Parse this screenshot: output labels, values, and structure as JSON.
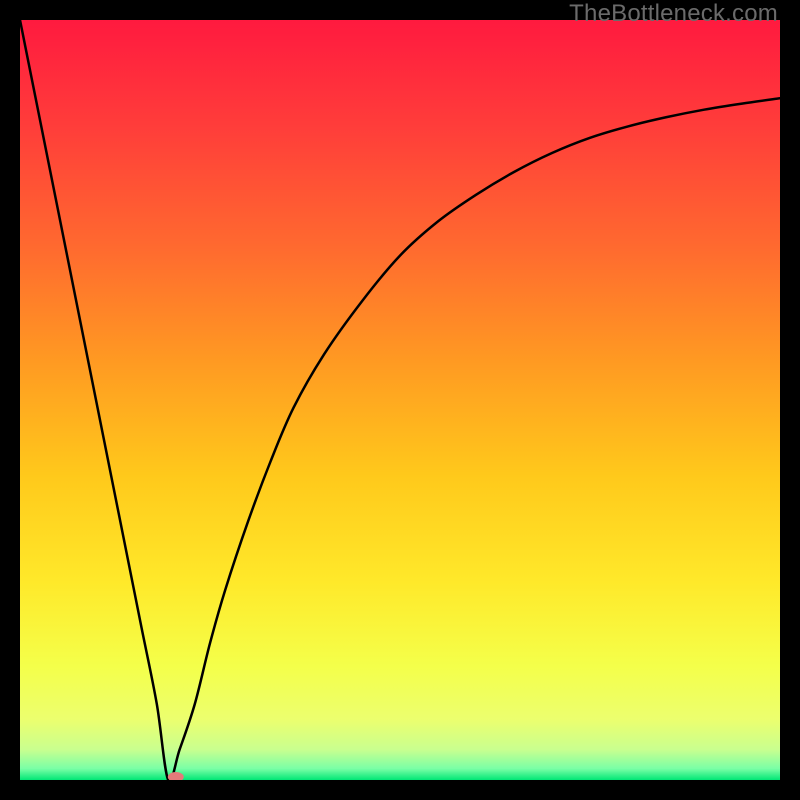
{
  "watermark": "TheBottleneck.com",
  "chart_data": {
    "type": "line",
    "title": "",
    "xlabel": "",
    "ylabel": "",
    "xlim": [
      0,
      100
    ],
    "ylim": [
      0,
      100
    ],
    "x": [
      0,
      2,
      4,
      6,
      8,
      10,
      12,
      14,
      16,
      18,
      19.5,
      21,
      23,
      25,
      27,
      30,
      33,
      36,
      40,
      45,
      50,
      55,
      60,
      65,
      70,
      75,
      80,
      85,
      90,
      95,
      100
    ],
    "values": [
      100,
      90,
      80,
      70,
      60,
      50,
      40,
      30,
      20,
      10,
      0,
      4,
      10,
      18,
      25,
      34,
      42,
      49,
      56,
      63,
      69,
      73.5,
      77,
      80,
      82.5,
      84.5,
      86,
      87.2,
      88.2,
      89,
      89.7
    ],
    "marker": {
      "x": 20.5,
      "y": 0
    },
    "gradient_stops": [
      {
        "offset": 0.0,
        "color": "#ff1a3f"
      },
      {
        "offset": 0.14,
        "color": "#ff3d3a"
      },
      {
        "offset": 0.3,
        "color": "#ff6a2f"
      },
      {
        "offset": 0.45,
        "color": "#ff9a22"
      },
      {
        "offset": 0.6,
        "color": "#ffc91b"
      },
      {
        "offset": 0.74,
        "color": "#ffe92a"
      },
      {
        "offset": 0.85,
        "color": "#f4ff4a"
      },
      {
        "offset": 0.92,
        "color": "#ecff6e"
      },
      {
        "offset": 0.96,
        "color": "#c9ff8f"
      },
      {
        "offset": 0.985,
        "color": "#7affa6"
      },
      {
        "offset": 1.0,
        "color": "#00e676"
      }
    ]
  }
}
